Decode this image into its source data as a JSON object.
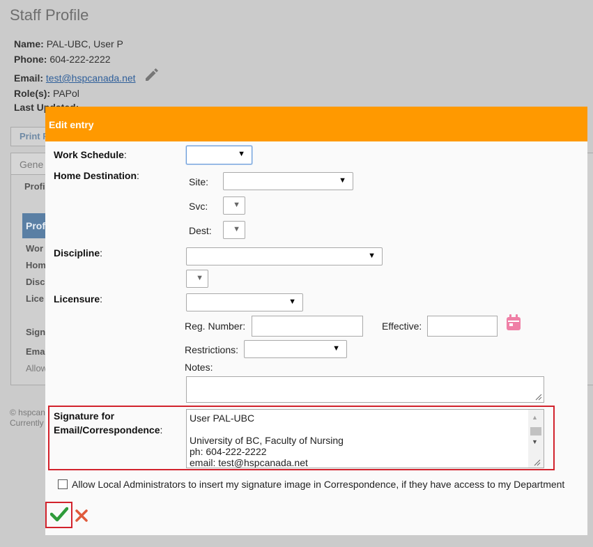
{
  "background": {
    "title": "Staff Profile",
    "name_label": "Name:",
    "name_value": "PAL-UBC, User P",
    "phone_label": "Phone:",
    "phone_value": "604-222-2222",
    "email_label": "Email:",
    "email_value": "test@hspcanada.net",
    "roles_label": "Role(s):",
    "roles_value": "PAPol",
    "updated_label": "Last Updated:",
    "print_button": "Print F",
    "tab_general": "Gene",
    "profile_label": "Profi",
    "profile_header": "Profi",
    "rows": [
      "Wor",
      "Hom",
      "Disc",
      "Lice"
    ],
    "sign_label": "Sign",
    "email_row": "Ema",
    "allow_row": "Allow",
    "footer_line1": "© hspcan",
    "footer_line2": "Currently"
  },
  "modal": {
    "title": "Edit entry",
    "header_color": "#ff9900",
    "work_schedule_label": "Work Schedule",
    "home_destination_label": "Home Destination",
    "site_label": "Site:",
    "svc_label": "Svc:",
    "dest_label": "Dest:",
    "discipline_label": "Discipline",
    "licensure_label": "Licensure",
    "reg_number_label": "Reg. Number:",
    "effective_label": "Effective:",
    "restrictions_label": "Restrictions:",
    "notes_label": "Notes:",
    "signature_label_line1": "Signature for",
    "signature_label_line2": "Email/Correspondence",
    "signature_text": "User PAL-UBC\n\nUniversity of BC, Faculty of Nursing\nph: 604-222-2222\nemail: test@hspcanada.net",
    "allow_checkbox_label": "Allow Local Administrators to insert my signature image in Correspondence, if they have access to my Department",
    "colon": ":",
    "save_icon": "checkmark-icon",
    "cancel_icon": "close-icon",
    "highlight_color": "#d2222c"
  }
}
